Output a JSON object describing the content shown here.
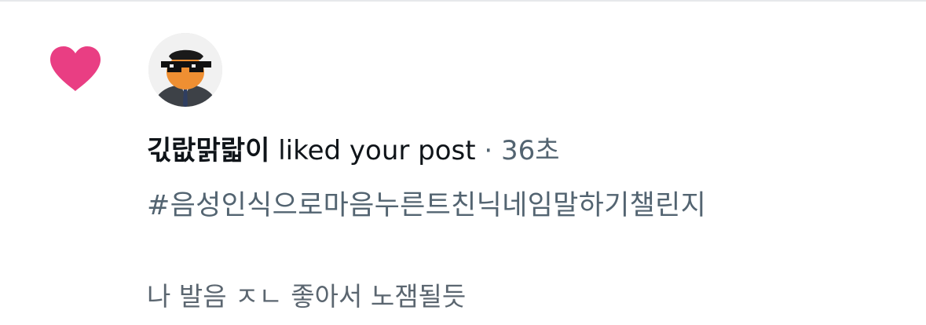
{
  "notification": {
    "icon": "heart-icon",
    "icon_color": "#e93e83",
    "user_name": "긳랎맑랇이",
    "action_text": " liked your post",
    "separator": " · ",
    "timestamp": "36초",
    "hashtag": "#음성인식으로마음누른트친닉네임말하기챌린지",
    "reply_text": "나 발음 ㅈㄴ 좋아서 노잼될듯"
  }
}
